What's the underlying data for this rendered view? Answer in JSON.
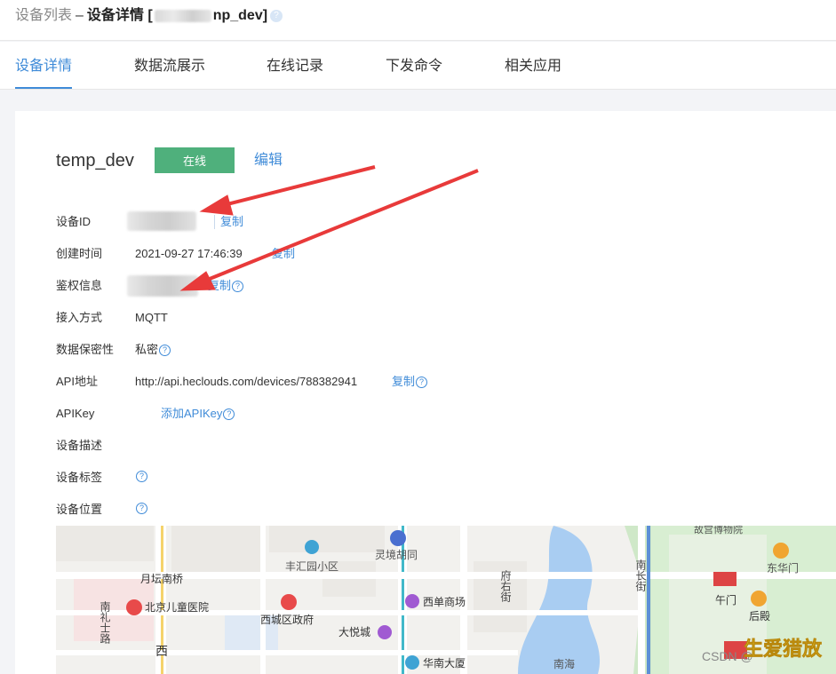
{
  "breadcrumb": {
    "list": "设备列表",
    "separator": "–",
    "detail": "设备详情 [",
    "suffix": "np_dev]",
    "help": "?"
  },
  "tabs": [
    {
      "label": "设备详情"
    },
    {
      "label": "数据流展示"
    },
    {
      "label": "在线记录"
    },
    {
      "label": "下发命令"
    },
    {
      "label": "相关应用"
    }
  ],
  "device": {
    "name": "temp_dev",
    "status": "在线",
    "edit": "编辑"
  },
  "fields": {
    "device_id": {
      "label": "设备ID",
      "copy": "复制"
    },
    "created": {
      "label": "创建时间",
      "value": "2021-09-27 17:46:39",
      "copy": "复制"
    },
    "auth": {
      "label": "鉴权信息",
      "copy": "复制"
    },
    "access": {
      "label": "接入方式",
      "value": "MQTT"
    },
    "privacy": {
      "label": "数据保密性",
      "value": "私密"
    },
    "api_addr": {
      "label": "API地址",
      "value": "http://api.heclouds.com/devices/788382941",
      "copy": "复制"
    },
    "apikey": {
      "label": "APIKey",
      "add": "添加APIKey"
    },
    "desc": {
      "label": "设备描述"
    },
    "tags": {
      "label": "设备标签"
    },
    "location": {
      "label": "设备位置"
    }
  },
  "help_glyph": "?",
  "map": {
    "labels": {
      "fengui": "丰汇园小区",
      "lingjing": "灵境胡同",
      "fuyoujie": "府右街",
      "gugong": "故宫博物院",
      "donghuamen": "东华门",
      "yuetan": "月坛南桥",
      "ertong": "北京儿童医院",
      "nanlishilu": "南礼士路",
      "xicheng": "西城区政府",
      "xidan": "西单商场",
      "dayuecheng": "大悦城",
      "huanan": "华南大厦",
      "nanhai": "南海",
      "nanchangjie": "南长街",
      "wumen": "午门",
      "houdian": "后殿",
      "xi": "西",
      "watermark": "CSDN @",
      "watermark2": "生爱猎放"
    }
  },
  "colors": {
    "accent": "#3f8bd8",
    "online": "#4fb07c",
    "arrow": "#e83a3a"
  }
}
